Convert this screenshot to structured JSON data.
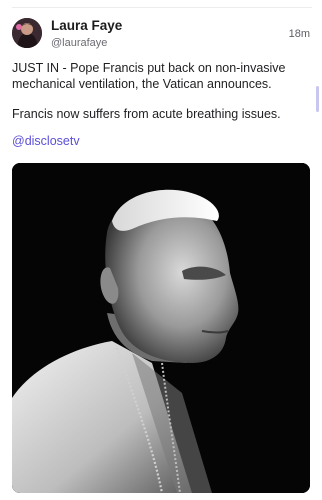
{
  "post": {
    "author_name": "Laura Faye",
    "author_handle": "@laurafaye",
    "time": "18m",
    "paragraphs": [
      "JUST IN - Pope Francis put back on non-invasive mechanical ventilation, the Vatican announces.",
      "Francis now suffers from acute breathing issues."
    ],
    "hashtag": "@disclosetv",
    "image_description_icon": "photo-portrait"
  },
  "colors": {
    "link": "#5b4fd8",
    "divider": "#ececef",
    "scrollbar": "#c9c6f0"
  }
}
